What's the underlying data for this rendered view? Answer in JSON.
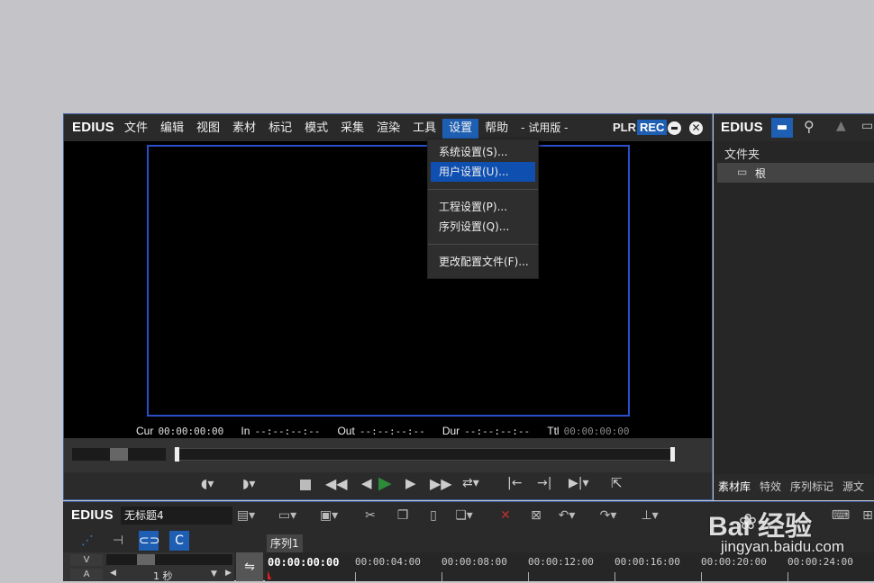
{
  "player": {
    "brand": "EDIUS",
    "menu": [
      "文件",
      "编辑",
      "视图",
      "素材",
      "标记",
      "模式",
      "采集",
      "渲染",
      "工具",
      "设置",
      "帮助"
    ],
    "active_menu_index": 9,
    "edition": "- 试用版 -",
    "plr": "PLR",
    "rec": "REC",
    "timecodes": {
      "cur_label": "Cur",
      "cur_value": "00:00:00:00",
      "in_label": "In",
      "in_value": "--:--:--:--",
      "out_label": "Out",
      "out_value": "--:--:--:--",
      "dur_label": "Dur",
      "dur_value": "--:--:--:--",
      "ttl_label": "Ttl",
      "ttl_value": "00:00:00:00"
    }
  },
  "settings_dropdown": {
    "groups": [
      [
        "系统设置(S)...",
        "用户设置(U)..."
      ],
      [
        "工程设置(P)...",
        "序列设置(Q)..."
      ],
      [
        "更改配置文件(F)..."
      ]
    ],
    "highlighted": "用户设置(U)..."
  },
  "bin": {
    "brand": "EDIUS",
    "folder_header": "文件夹",
    "root_folder": "根",
    "tabs": [
      "素材库",
      "特效",
      "序列标记",
      "源文"
    ]
  },
  "timeline": {
    "brand": "EDIUS",
    "project_name": "无标题4",
    "sequence_tab": "序列1",
    "track_v": "V",
    "track_a": "A",
    "scale_label": "1 秒",
    "current_tc": "00:00:00:00",
    "ruler": [
      "00:00:04:00",
      "00:00:08:00",
      "00:00:12:00",
      "00:00:16:00",
      "00:00:20:00",
      "00:00:24:00"
    ]
  },
  "watermark": {
    "text": "Bai 经验",
    "url": "jingyan.baidu.com"
  },
  "colors": {
    "accent_blue": "#1e5fb3",
    "highlight_blue": "#0f4fb0",
    "preview_border": "#2b4fc9",
    "play_green": "#2e8b3a"
  }
}
